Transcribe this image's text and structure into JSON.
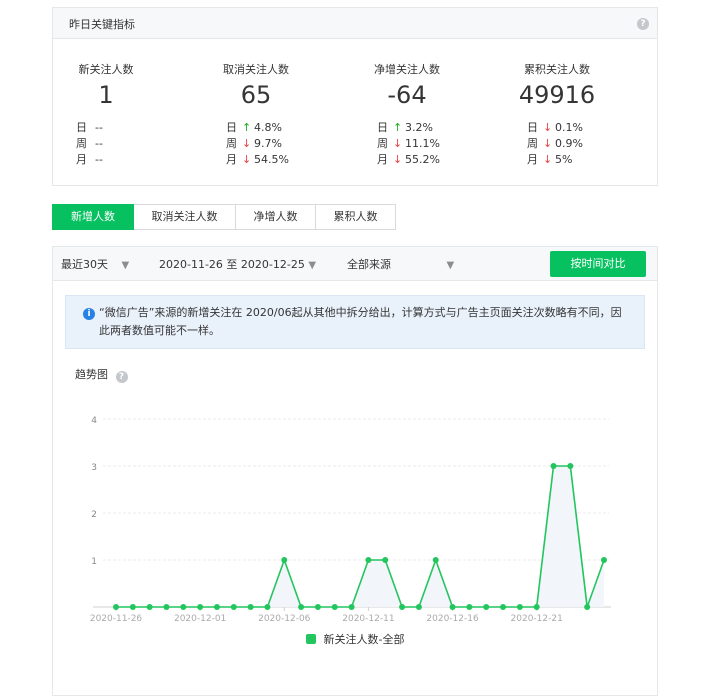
{
  "summary": {
    "title": "昨日关键指标",
    "metrics": [
      {
        "label": "新关注人数",
        "value": "1",
        "rows": [
          {
            "label": "日",
            "dir": "",
            "value": "--"
          },
          {
            "label": "周",
            "dir": "",
            "value": "--"
          },
          {
            "label": "月",
            "dir": "",
            "value": "--"
          }
        ]
      },
      {
        "label": "取消关注人数",
        "value": "65",
        "rows": [
          {
            "label": "日",
            "dir": "up",
            "value": "4.8%"
          },
          {
            "label": "周",
            "dir": "down",
            "value": "9.7%"
          },
          {
            "label": "月",
            "dir": "down",
            "value": "54.5%"
          }
        ]
      },
      {
        "label": "净增关注人数",
        "value": "-64",
        "rows": [
          {
            "label": "日",
            "dir": "up",
            "value": "3.2%"
          },
          {
            "label": "周",
            "dir": "down",
            "value": "11.1%"
          },
          {
            "label": "月",
            "dir": "down",
            "value": "55.2%"
          }
        ]
      },
      {
        "label": "累积关注人数",
        "value": "49916",
        "rows": [
          {
            "label": "日",
            "dir": "down",
            "value": "0.1%"
          },
          {
            "label": "周",
            "dir": "down",
            "value": "0.9%"
          },
          {
            "label": "月",
            "dir": "down",
            "value": "5%"
          }
        ]
      }
    ]
  },
  "tabs": [
    "新增人数",
    "取消关注人数",
    "净增人数",
    "累积人数"
  ],
  "filters": {
    "period": "最近30天",
    "date_range": "2020-11-26 至 2020-12-25",
    "source": "全部来源",
    "compare_button": "按时间对比"
  },
  "notice": "“微信广告”来源的新增关注在 2020/06起从其他中拆分给出，计算方式与广告主页面关注次数略有不同，因此两者数值可能不一样。",
  "trend_title": "趋势图",
  "colors": {
    "accent": "#07c160",
    "line": "#22c55e",
    "up": "#1aad19",
    "down": "#e64340"
  },
  "chart_data": {
    "type": "line",
    "x": [
      "2020-11-26",
      "2020-11-27",
      "2020-11-28",
      "2020-11-29",
      "2020-11-30",
      "2020-12-01",
      "2020-12-02",
      "2020-12-03",
      "2020-12-04",
      "2020-12-05",
      "2020-12-06",
      "2020-12-07",
      "2020-12-08",
      "2020-12-09",
      "2020-12-10",
      "2020-12-11",
      "2020-12-12",
      "2020-12-13",
      "2020-12-14",
      "2020-12-15",
      "2020-12-16",
      "2020-12-17",
      "2020-12-18",
      "2020-12-19",
      "2020-12-20",
      "2020-12-21",
      "2020-12-22",
      "2020-12-23",
      "2020-12-24",
      "2020-12-25"
    ],
    "x_ticks": [
      "2020-11-26",
      "2020-12-01",
      "2020-12-06",
      "2020-12-11",
      "2020-12-16",
      "2020-12-21"
    ],
    "y_ticks": [
      1,
      2,
      3,
      4
    ],
    "ylim": [
      0,
      4
    ],
    "series": [
      {
        "name": "新关注人数-全部",
        "values": [
          0,
          0,
          0,
          0,
          0,
          0,
          0,
          0,
          0,
          0,
          1,
          0,
          0,
          0,
          0,
          1,
          1,
          0,
          0,
          1,
          0,
          0,
          0,
          0,
          0,
          0,
          3,
          3,
          0,
          1
        ]
      }
    ]
  }
}
